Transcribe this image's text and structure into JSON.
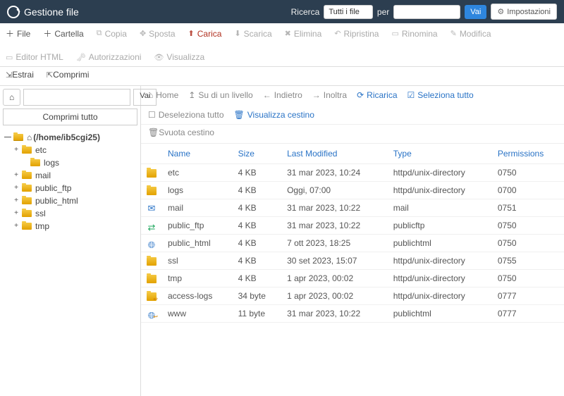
{
  "topbar": {
    "title": "Gestione file",
    "search_label": "Ricerca",
    "select_value": "Tutti i file",
    "for_label": "per",
    "search_value": "",
    "go": "Vai",
    "settings": "Impostazioni"
  },
  "toolbar": {
    "file": "File",
    "folder": "Cartella",
    "copy": "Copia",
    "move": "Sposta",
    "upload": "Carica",
    "download": "Scarica",
    "delete": "Elimina",
    "restore": "Ripristina",
    "rename": "Rinomina",
    "edit": "Modifica",
    "html_editor": "Editor HTML",
    "perms": "Autorizzazioni",
    "view": "Visualizza",
    "extract": "Estrai",
    "compress": "Comprimi"
  },
  "side": {
    "go": "Vai",
    "collapse": "Comprimi tutto",
    "root": "(/home/ib5cgi25)",
    "tree": [
      "etc",
      "logs",
      "mail",
      "public_ftp",
      "public_html",
      "ssl",
      "tmp"
    ]
  },
  "actionbar": {
    "home": "Home",
    "up": "Su di un livello",
    "back": "Indietro",
    "forward": "Inoltra",
    "reload": "Ricarica",
    "select_all": "Seleziona tutto",
    "deselect": "Deseleziona tutto",
    "view_trash": "Visualizza cestino",
    "empty_trash": "Svuota cestino"
  },
  "table": {
    "headers": {
      "name": "Name",
      "size": "Size",
      "modified": "Last Modified",
      "type": "Type",
      "perms": "Permissions"
    },
    "rows": [
      {
        "icon": "folder",
        "name": "etc",
        "size": "4 KB",
        "modified": "31 mar 2023, 10:24",
        "type": "httpd/unix-directory",
        "perms": "0750"
      },
      {
        "icon": "folder",
        "name": "logs",
        "size": "4 KB",
        "modified": "Oggi, 07:00",
        "type": "httpd/unix-directory",
        "perms": "0700"
      },
      {
        "icon": "mail",
        "name": "mail",
        "size": "4 KB",
        "modified": "31 mar 2023, 10:22",
        "type": "mail",
        "perms": "0751"
      },
      {
        "icon": "ftp",
        "name": "public_ftp",
        "size": "4 KB",
        "modified": "31 mar 2023, 10:22",
        "type": "publicftp",
        "perms": "0750"
      },
      {
        "icon": "globe",
        "name": "public_html",
        "size": "4 KB",
        "modified": "7 ott 2023, 18:25",
        "type": "publichtml",
        "perms": "0750"
      },
      {
        "icon": "folder",
        "name": "ssl",
        "size": "4 KB",
        "modified": "30 set 2023, 15:07",
        "type": "httpd/unix-directory",
        "perms": "0755"
      },
      {
        "icon": "folder",
        "name": "tmp",
        "size": "4 KB",
        "modified": "1 apr 2023, 00:02",
        "type": "httpd/unix-directory",
        "perms": "0750"
      },
      {
        "icon": "folder-link",
        "name": "access-logs",
        "size": "34 byte",
        "modified": "1 apr 2023, 00:02",
        "type": "httpd/unix-directory",
        "perms": "0777"
      },
      {
        "icon": "globe-link",
        "name": "www",
        "size": "11 byte",
        "modified": "31 mar 2023, 10:22",
        "type": "publichtml",
        "perms": "0777"
      }
    ]
  }
}
